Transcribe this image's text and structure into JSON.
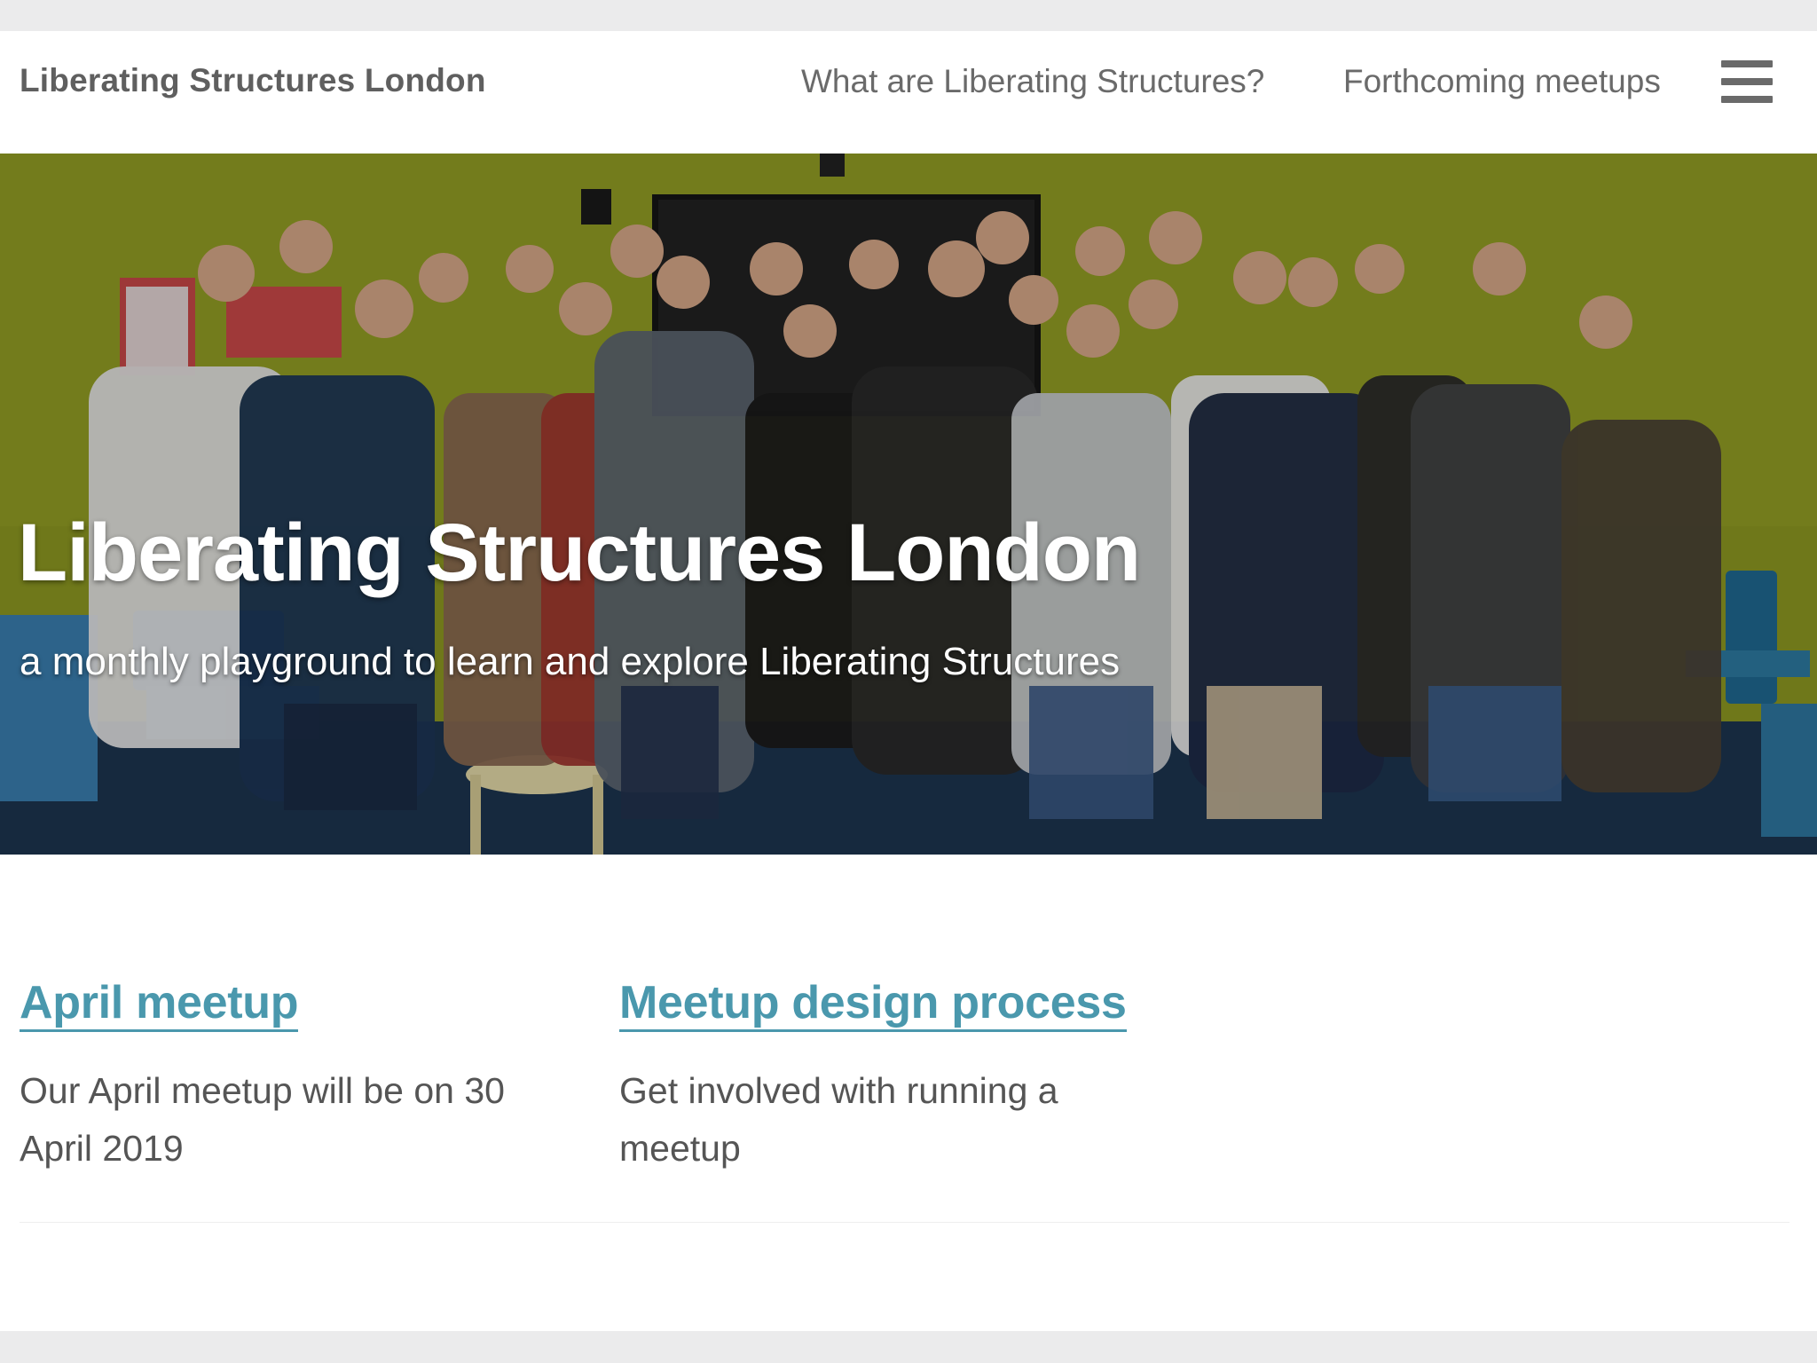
{
  "header": {
    "site_title": "Liberating Structures London",
    "nav": [
      {
        "label": "What are Liberating Structures?"
      },
      {
        "label": "Forthcoming meetups"
      }
    ],
    "menu_icon": "hamburger-menu-icon"
  },
  "hero": {
    "title": "Liberating Structures London",
    "subtitle": "a monthly playground to learn and explore Liberating Structures",
    "image": "group-photo"
  },
  "posts": [
    {
      "title": "April meetup",
      "summary": "Our April meetup will be on 30 April 2019"
    },
    {
      "title": "Meetup design process",
      "summary": "Get involved with running a meetup"
    }
  ],
  "colors": {
    "link": "#4a98ad",
    "header_text": "#5f5f5f",
    "wall": "#8f9a22"
  }
}
